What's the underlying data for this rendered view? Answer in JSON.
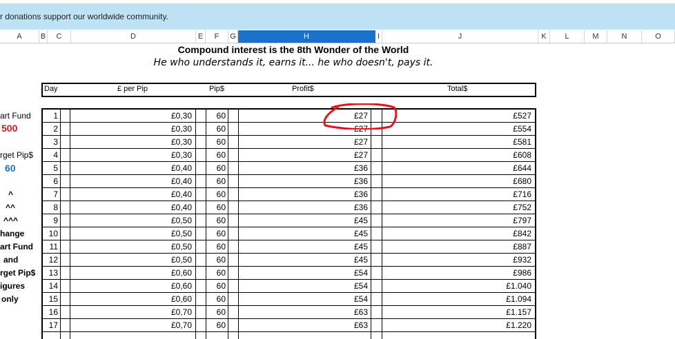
{
  "banner": {
    "text": "r donations support our worldwide community."
  },
  "columns": [
    "A",
    "B",
    "C",
    "D",
    "E",
    "F",
    "G",
    "H",
    "I",
    "J",
    "K",
    "L",
    "M",
    "N",
    "O"
  ],
  "selected_column": "H",
  "title": "Compound interest is the 8th Wonder of the World",
  "subtitle": "He who understands it, earns it... he who doesn't, pays it.",
  "table_headers": {
    "day": "Day",
    "per_pip": "£ per Pip",
    "pips": "Pip$",
    "profit": "Profit$",
    "total": "Total$"
  },
  "side": {
    "start_fund_label": "art Fund",
    "start_fund_value": "500",
    "target_label": "rget Pip$",
    "target_value": "60",
    "caret1": "^",
    "caret2": "^^",
    "caret3": "^^^",
    "line1": "hange",
    "line2": "art Fund",
    "line3": "and",
    "line4": "rget Pip$",
    "line5": "igures",
    "line6": "only"
  },
  "colors": {
    "selected_header": "#1a73c9",
    "banner": "#bde3f4",
    "annotation": "#e3131b",
    "start_fund": "#e3131b",
    "target": "#1f6fc2"
  },
  "rows": [
    {
      "day": "1",
      "per_pip": "£0,30",
      "pips": "60",
      "profit": "£27",
      "total": "£527"
    },
    {
      "day": "2",
      "per_pip": "£0,30",
      "pips": "60",
      "profit": "£27",
      "total": "£554"
    },
    {
      "day": "3",
      "per_pip": "£0,30",
      "pips": "60",
      "profit": "£27",
      "total": "£581"
    },
    {
      "day": "4",
      "per_pip": "£0,30",
      "pips": "60",
      "profit": "£27",
      "total": "£608"
    },
    {
      "day": "5",
      "per_pip": "£0,40",
      "pips": "60",
      "profit": "£36",
      "total": "£644"
    },
    {
      "day": "6",
      "per_pip": "£0,40",
      "pips": "60",
      "profit": "£36",
      "total": "£680"
    },
    {
      "day": "7",
      "per_pip": "£0,40",
      "pips": "60",
      "profit": "£36",
      "total": "£716"
    },
    {
      "day": "8",
      "per_pip": "£0,40",
      "pips": "60",
      "profit": "£36",
      "total": "£752"
    },
    {
      "day": "9",
      "per_pip": "£0,50",
      "pips": "60",
      "profit": "£45",
      "total": "£797"
    },
    {
      "day": "10",
      "per_pip": "£0,50",
      "pips": "60",
      "profit": "£45",
      "total": "£842"
    },
    {
      "day": "11",
      "per_pip": "£0,50",
      "pips": "60",
      "profit": "£45",
      "total": "£887"
    },
    {
      "day": "12",
      "per_pip": "£0,50",
      "pips": "60",
      "profit": "£45",
      "total": "£932"
    },
    {
      "day": "13",
      "per_pip": "£0,60",
      "pips": "60",
      "profit": "£54",
      "total": "£986"
    },
    {
      "day": "14",
      "per_pip": "£0,60",
      "pips": "60",
      "profit": "£54",
      "total": "£1.040"
    },
    {
      "day": "15",
      "per_pip": "£0,60",
      "pips": "60",
      "profit": "£54",
      "total": "£1.094"
    },
    {
      "day": "16",
      "per_pip": "£0,70",
      "pips": "60",
      "profit": "£63",
      "total": "£1.157"
    },
    {
      "day": "17",
      "per_pip": "£0,70",
      "pips": "60",
      "profit": "£63",
      "total": "£1.220"
    }
  ]
}
